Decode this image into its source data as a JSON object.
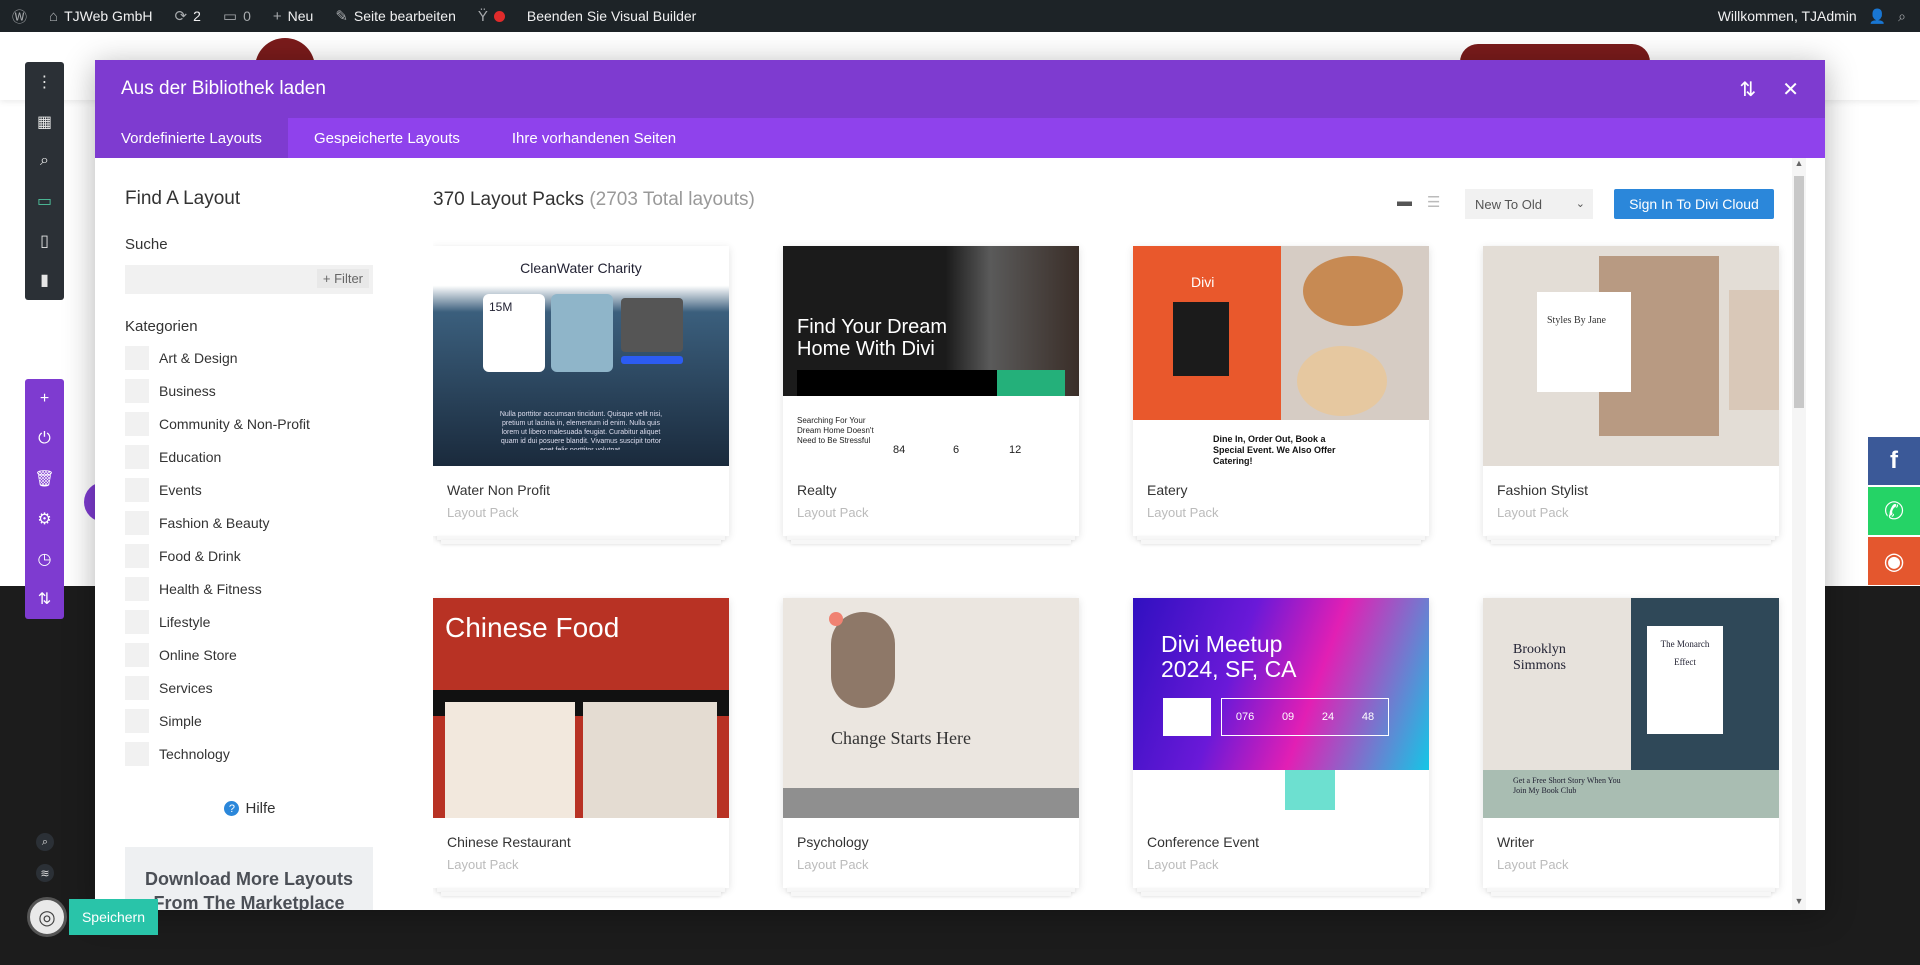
{
  "adminbar": {
    "site_name": "TJWeb GmbH",
    "updates_count": "2",
    "comments_count": "0",
    "new_label": "Neu",
    "edit_label": "Seite bearbeiten",
    "exit_builder_label": "Beenden Sie Visual Builder",
    "welcome": "Willkommen, TJAdmin"
  },
  "modal": {
    "title": "Aus der Bibliothek laden",
    "tabs": [
      {
        "label": "Vordefinierte Layouts",
        "active": true
      },
      {
        "label": "Gespeicherte Layouts",
        "active": false
      },
      {
        "label": "Ihre vorhandenen Seiten",
        "active": false
      }
    ]
  },
  "sidebar": {
    "heading": "Find A Layout",
    "search_label": "Suche",
    "search_placeholder": "",
    "filter_label": "+ Filter",
    "categories_label": "Kategorien",
    "categories": [
      "Art & Design",
      "Business",
      "Community & Non-Profit",
      "Education",
      "Events",
      "Fashion & Beauty",
      "Food & Drink",
      "Health & Fitness",
      "Lifestyle",
      "Online Store",
      "Services",
      "Simple",
      "Technology"
    ],
    "help_label": "Hilfe",
    "download_label": "Download More Layouts From The Marketplace"
  },
  "content": {
    "pack_count": "370 Layout Packs",
    "total_layouts": "(2703 Total layouts)",
    "sort_value": "New To Old",
    "signin_label": "Sign In To Divi Cloud",
    "layouts": [
      {
        "name": "Water Non Profit",
        "type": "Layout Pack",
        "thumb_title": "CleanWater Charity",
        "thumb_stat": "15M",
        "thumb_text": "Nulla porttitor accumsan tincidunt. Quisque velit nisi, pretium ut lacinia in, elementum id enim. Nulla quis lorem ut libero malesuada feugiat. Curabitur aliquet quam id dui posuere blandit. Vivamus suscipit tortor eget felis porttitor volutpat."
      },
      {
        "name": "Realty",
        "type": "Layout Pack",
        "thumb_title": "Find Your Dream Home With Divi",
        "thumb_sub": "Searching For Your Dream Home Doesn't Need to Be Stressful",
        "thumb_stats": [
          "84",
          "6",
          "12"
        ]
      },
      {
        "name": "Eatery",
        "type": "Layout Pack",
        "thumb_brand": "Divi",
        "thumb_text": "Dine In, Order Out, Book a Special Event. We Also Offer Catering!"
      },
      {
        "name": "Fashion Stylist",
        "type": "Layout Pack",
        "thumb_title": "Styles By Jane"
      },
      {
        "name": "Chinese Restaurant",
        "type": "Layout Pack",
        "thumb_title": "Chinese Food"
      },
      {
        "name": "Psychology",
        "type": "Layout Pack",
        "thumb_title": "Change Starts Here"
      },
      {
        "name": "Conference Event",
        "type": "Layout Pack",
        "thumb_title": "Divi Meetup 2024, SF, CA",
        "thumb_countdown": [
          "076",
          "09",
          "24",
          "48"
        ]
      },
      {
        "name": "Writer",
        "type": "Layout Pack",
        "thumb_title": "Brooklyn Simmons",
        "thumb_book": "The Monarch Effect",
        "thumb_text": "Get a Free Short Story When You Join My Book Club"
      }
    ]
  },
  "builder": {
    "save_label": "Speichern"
  },
  "colors": {
    "modal_header": "#7e3bd0",
    "tabs_bar": "#8f42ec",
    "signin": "#2b87da",
    "save": "#29c4a9",
    "facebook": "#3b5998",
    "whatsapp": "#25d366",
    "instagram": "#e4572e"
  },
  "social": [
    "facebook-icon",
    "whatsapp-icon",
    "instagram-icon"
  ]
}
